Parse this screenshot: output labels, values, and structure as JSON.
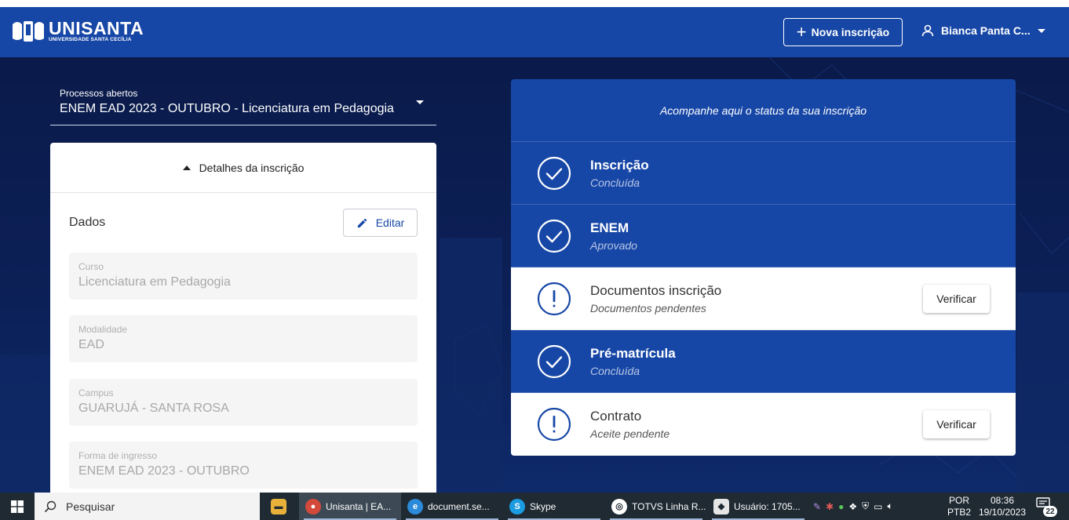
{
  "header": {
    "logo_name": "UNISANTA",
    "logo_subtitle": "UNIVERSIDADE SANTA CECÍLIA",
    "new_button_label": "Nova inscrição",
    "user_name": "Bianca Panta C...",
    "brand_color": "#1747a6"
  },
  "process": {
    "label": "Processos abertos",
    "value": "ENEM EAD 2023 - OUTUBRO - Licenciatura em Pedagogia"
  },
  "details": {
    "toggle_label": "Detalhes da inscrição",
    "section_title": "Dados",
    "edit_label": "Editar",
    "fields": [
      {
        "label": "Curso",
        "value": "Licenciatura em Pedagogia"
      },
      {
        "label": "Modalidade",
        "value": "EAD"
      },
      {
        "label": "Campus",
        "value": "GUARUJÁ - SANTA ROSA"
      },
      {
        "label": "Forma de ingresso",
        "value": "ENEM EAD 2023 - OUTUBRO"
      }
    ]
  },
  "status": {
    "heading": "Acompanhe aqui o status da sua inscrição",
    "steps": [
      {
        "title": "Inscrição",
        "subtitle": "Concluída",
        "state": "done",
        "icon": "check-circle-icon"
      },
      {
        "title": "ENEM",
        "subtitle": "Aprovado",
        "state": "done",
        "icon": "check-circle-icon"
      },
      {
        "title": "Documentos inscrição",
        "subtitle": "Documentos pendentes",
        "state": "pending",
        "icon": "alert-circle-icon",
        "action": "Verificar"
      },
      {
        "title": "Pré-matrícula",
        "subtitle": "Concluída",
        "state": "done",
        "icon": "check-circle-icon"
      },
      {
        "title": "Contrato",
        "subtitle": "Aceite pendente",
        "state": "pending",
        "icon": "alert-circle-icon",
        "action": "Verificar"
      }
    ]
  },
  "taskbar": {
    "search_placeholder": "Pesquisar",
    "apps": [
      {
        "label": "",
        "icon": "file-explorer-icon"
      },
      {
        "label": "Unisanta | EA...",
        "icon": "chrome-icon"
      },
      {
        "label": "document.se...",
        "icon": "edge-icon"
      },
      {
        "label": "Skype",
        "icon": "skype-icon"
      },
      {
        "label": "TOTVS Linha R...",
        "icon": "totvs-icon"
      },
      {
        "label": "Usuário: 1705...",
        "icon": "app-icon"
      }
    ],
    "lang_top": "POR",
    "lang_bottom": "PTB2",
    "time": "08:36",
    "date": "19/10/2023",
    "notification_count": "22"
  }
}
